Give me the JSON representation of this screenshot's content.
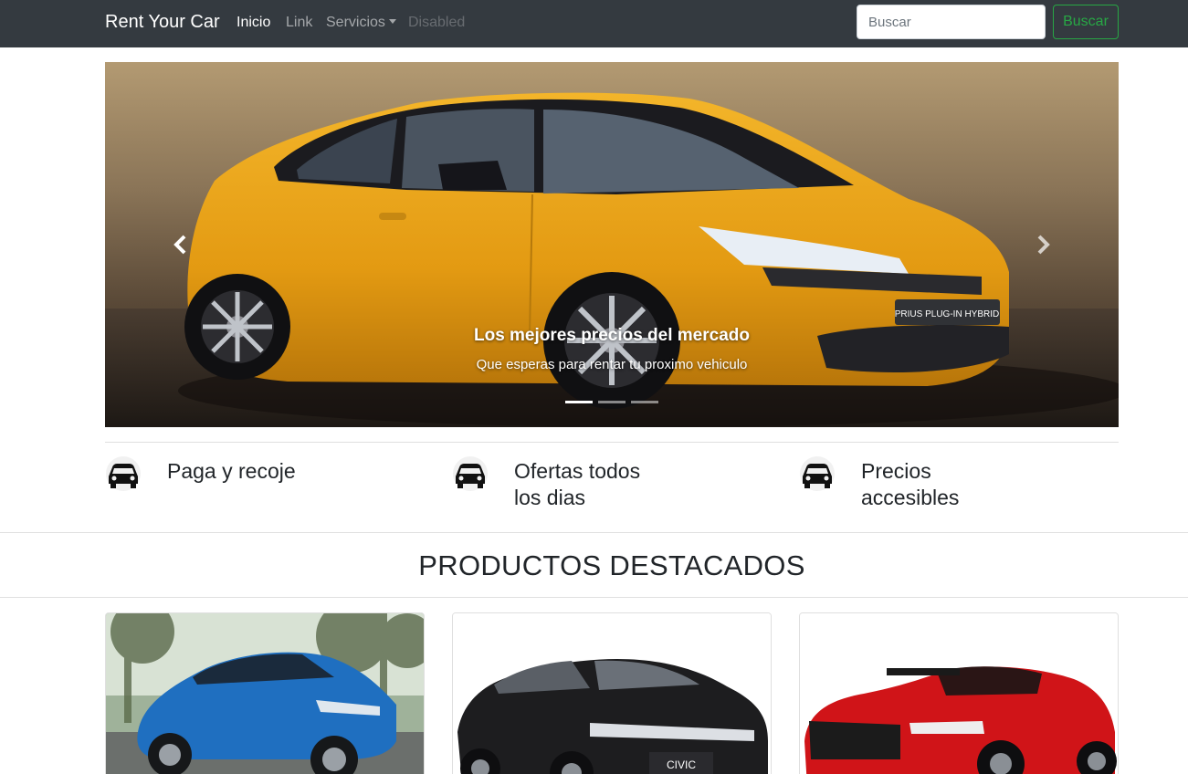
{
  "navbar": {
    "brand": "Rent Your Car",
    "links": [
      {
        "label": "Inicio",
        "state": "active"
      },
      {
        "label": "Link",
        "state": "normal"
      },
      {
        "label": "Servicios",
        "state": "dropdown"
      },
      {
        "label": "Disabled",
        "state": "disabled"
      }
    ],
    "search": {
      "placeholder": "Buscar",
      "value": ""
    },
    "search_button": "Buscar"
  },
  "carousel": {
    "slide": {
      "title": "Los mejores precios del mercado",
      "subtitle": "Que esperas para rentar tu proximo vehiculo",
      "plate_text": "PRIUS PLUG-IN HYBRID"
    },
    "indicators": 3,
    "active_indicator": 0,
    "controls": {
      "prev_icon": "chevron-left-icon",
      "next_icon": "chevron-right-icon"
    }
  },
  "features": [
    {
      "icon": "car-icon",
      "text": "Paga y recoje"
    },
    {
      "icon": "car-icon",
      "text": "Ofertas todos los dias"
    },
    {
      "icon": "car-icon",
      "text": "Precios accesibles"
    }
  ],
  "products": {
    "title": "PRODUCTOS DESTACADOS",
    "cards": [
      {
        "color": "#1f6fc0"
      },
      {
        "color": "#1d1d1f",
        "badge": "CIVIC"
      },
      {
        "color": "#d01418"
      }
    ]
  },
  "colors": {
    "navbar_bg": "#343a40",
    "accent_success": "#28a745",
    "text": "#212529"
  }
}
